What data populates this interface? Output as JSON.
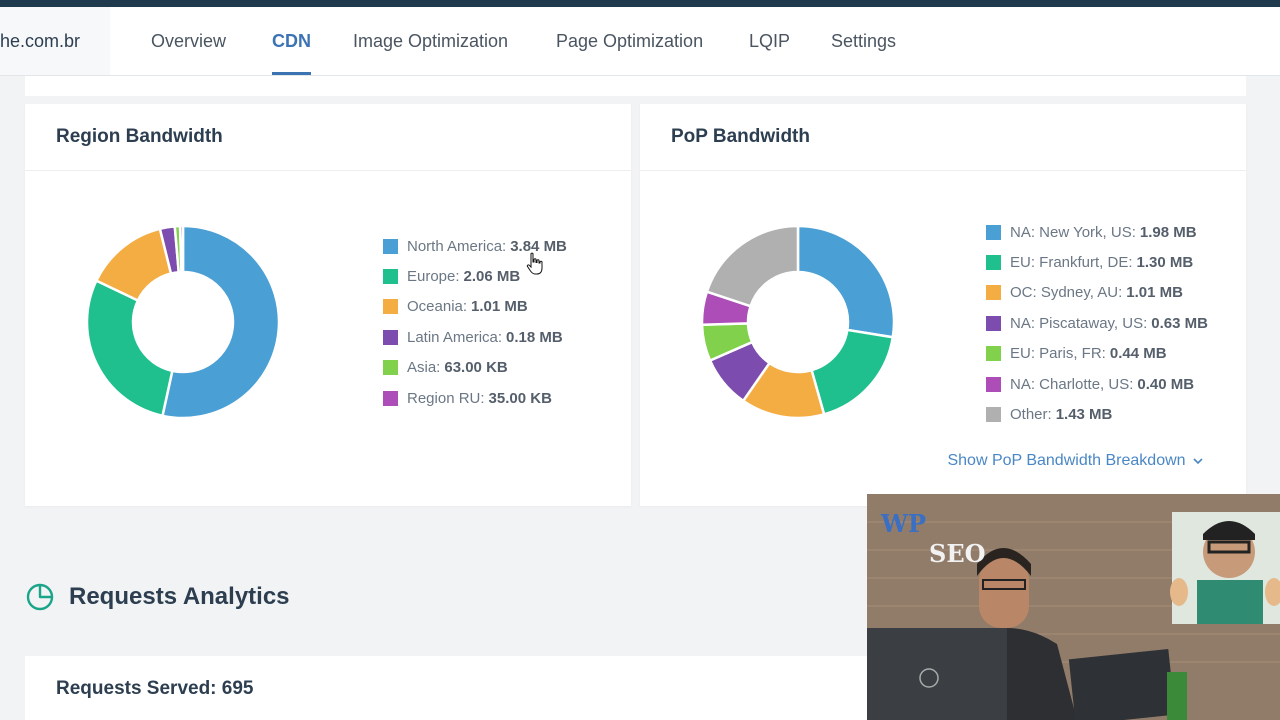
{
  "nav": {
    "site": "he.com.br",
    "tabs": [
      "Overview",
      "CDN",
      "Image Optimization",
      "Page Optimization",
      "LQIP",
      "Settings"
    ],
    "active": "CDN"
  },
  "region": {
    "title": "Region Bandwidth",
    "items": [
      {
        "label": "North America:",
        "value": "3.84 MB",
        "color": "#4a9fd4"
      },
      {
        "label": "Europe:",
        "value": "2.06 MB",
        "color": "#1fc08e"
      },
      {
        "label": "Oceania:",
        "value": "1.01 MB",
        "color": "#f4ad42"
      },
      {
        "label": "Latin America:",
        "value": "0.18 MB",
        "color": "#7c4dae"
      },
      {
        "label": "Asia:",
        "value": "63.00 KB",
        "color": "#82d14d"
      },
      {
        "label": "Region RU:",
        "value": "35.00 KB",
        "color": "#ad4db8"
      }
    ]
  },
  "pop": {
    "title": "PoP Bandwidth",
    "items": [
      {
        "label": "NA: New York, US:",
        "value": "1.98 MB",
        "color": "#4a9fd4"
      },
      {
        "label": "EU: Frankfurt, DE:",
        "value": "1.30 MB",
        "color": "#1fc08e"
      },
      {
        "label": "OC: Sydney, AU:",
        "value": "1.01 MB",
        "color": "#f4ad42"
      },
      {
        "label": "NA: Piscataway, US:",
        "value": "0.63 MB",
        "color": "#7c4dae"
      },
      {
        "label": "EU: Paris, FR:",
        "value": "0.44 MB",
        "color": "#82d14d"
      },
      {
        "label": "NA: Charlotte, US:",
        "value": "0.40 MB",
        "color": "#ad4db8"
      },
      {
        "label": "Other:",
        "value": "1.43 MB",
        "color": "#b0b0b0"
      }
    ],
    "breakdown_link": "Show PoP Bandwidth Breakdown"
  },
  "chart_data": [
    {
      "type": "pie",
      "title": "Region Bandwidth",
      "categories": [
        "North America",
        "Europe",
        "Oceania",
        "Latin America",
        "Asia",
        "Region RU"
      ],
      "values": [
        3.84,
        2.06,
        1.01,
        0.18,
        0.063,
        0.035
      ],
      "unit": "MB"
    },
    {
      "type": "pie",
      "title": "PoP Bandwidth",
      "categories": [
        "NA: New York, US",
        "EU: Frankfurt, DE",
        "OC: Sydney, AU",
        "NA: Piscataway, US",
        "EU: Paris, FR",
        "NA: Charlotte, US",
        "Other"
      ],
      "values": [
        1.98,
        1.3,
        1.01,
        0.63,
        0.44,
        0.4,
        1.43
      ],
      "unit": "MB"
    }
  ],
  "requests": {
    "section_title": "Requests Analytics",
    "served": "Requests Served: 695"
  },
  "webcam": {
    "caption_line1": "WP",
    "caption_line2": "SEO"
  }
}
